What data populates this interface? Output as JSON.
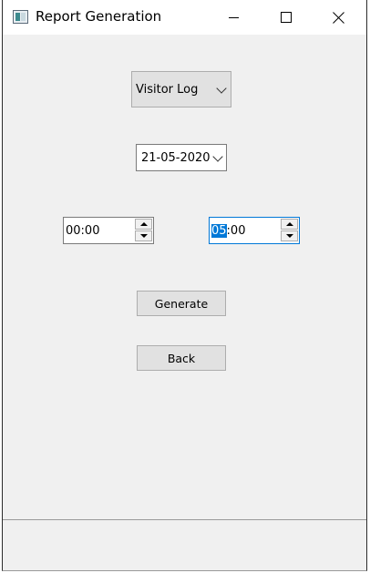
{
  "window": {
    "title": "Report Generation",
    "icon": "app-window-icon",
    "controls": [
      "minimize-icon",
      "maximize-icon",
      "close-icon"
    ]
  },
  "form": {
    "report_type": {
      "selected": "Visitor Log"
    },
    "date": {
      "selected": "21-05-2020"
    },
    "start_time": {
      "value": "00:00"
    },
    "end_time": {
      "hours_selected": "05",
      "rest": ":00"
    },
    "generate_label": "Generate",
    "back_label": "Back"
  },
  "colors": {
    "accent": "#0078d7",
    "window_bg": "#f0f0f0",
    "button_bg": "#e1e1e1"
  }
}
